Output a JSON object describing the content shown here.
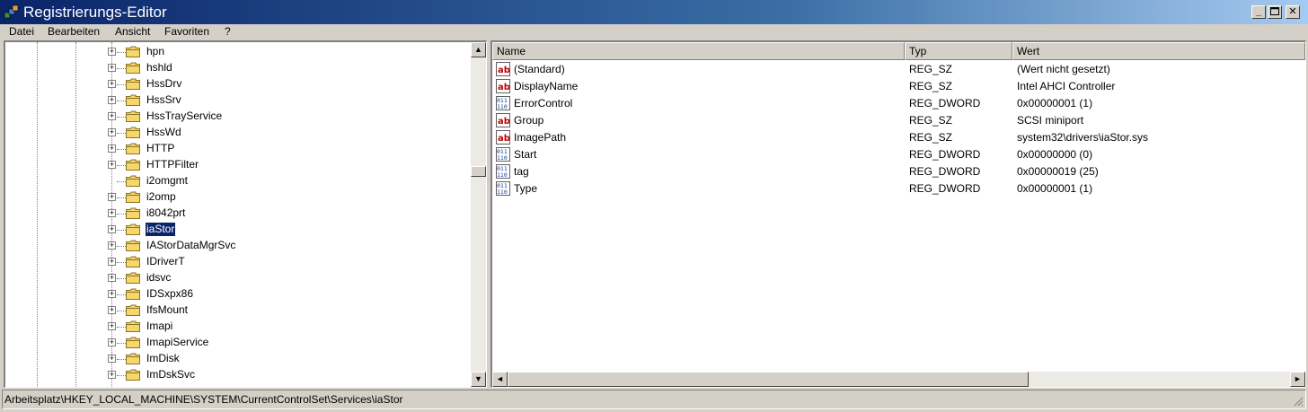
{
  "window": {
    "title": "Registrierungs-Editor"
  },
  "menu": [
    "Datei",
    "Bearbeiten",
    "Ansicht",
    "Favoriten",
    "?"
  ],
  "tree": {
    "items": [
      {
        "label": "hpn",
        "expandable": true,
        "selected": false
      },
      {
        "label": "hshld",
        "expandable": true,
        "selected": false
      },
      {
        "label": "HssDrv",
        "expandable": true,
        "selected": false
      },
      {
        "label": "HssSrv",
        "expandable": true,
        "selected": false
      },
      {
        "label": "HssTrayService",
        "expandable": true,
        "selected": false
      },
      {
        "label": "HssWd",
        "expandable": true,
        "selected": false
      },
      {
        "label": "HTTP",
        "expandable": true,
        "selected": false
      },
      {
        "label": "HTTPFilter",
        "expandable": true,
        "selected": false
      },
      {
        "label": "i2omgmt",
        "expandable": false,
        "selected": false
      },
      {
        "label": "i2omp",
        "expandable": true,
        "selected": false
      },
      {
        "label": "i8042prt",
        "expandable": true,
        "selected": false
      },
      {
        "label": "iaStor",
        "expandable": true,
        "selected": true
      },
      {
        "label": "IAStorDataMgrSvc",
        "expandable": true,
        "selected": false
      },
      {
        "label": "IDriverT",
        "expandable": true,
        "selected": false
      },
      {
        "label": "idsvc",
        "expandable": true,
        "selected": false
      },
      {
        "label": "IDSxpx86",
        "expandable": true,
        "selected": false
      },
      {
        "label": "IfsMount",
        "expandable": true,
        "selected": false
      },
      {
        "label": "Imapi",
        "expandable": true,
        "selected": false
      },
      {
        "label": "ImapiService",
        "expandable": true,
        "selected": false
      },
      {
        "label": "ImDisk",
        "expandable": true,
        "selected": false
      },
      {
        "label": "ImDskSvc",
        "expandable": true,
        "selected": false
      }
    ]
  },
  "values": {
    "columns": [
      "Name",
      "Typ",
      "Wert"
    ],
    "rows": [
      {
        "icon": "string-value-icon",
        "name": "(Standard)",
        "type": "REG_SZ",
        "data": "(Wert nicht gesetzt)"
      },
      {
        "icon": "string-value-icon",
        "name": "DisplayName",
        "type": "REG_SZ",
        "data": "Intel AHCI Controller"
      },
      {
        "icon": "binary-value-icon",
        "name": "ErrorControl",
        "type": "REG_DWORD",
        "data": "0x00000001 (1)"
      },
      {
        "icon": "string-value-icon",
        "name": "Group",
        "type": "REG_SZ",
        "data": "SCSI miniport"
      },
      {
        "icon": "string-value-icon",
        "name": "ImagePath",
        "type": "REG_SZ",
        "data": "system32\\drivers\\iaStor.sys"
      },
      {
        "icon": "binary-value-icon",
        "name": "Start",
        "type": "REG_DWORD",
        "data": "0x00000000 (0)"
      },
      {
        "icon": "binary-value-icon",
        "name": "tag",
        "type": "REG_DWORD",
        "data": "0x00000019 (25)"
      },
      {
        "icon": "binary-value-icon",
        "name": "Type",
        "type": "REG_DWORD",
        "data": "0x00000001 (1)"
      }
    ]
  },
  "status": {
    "path": "Arbeitsplatz\\HKEY_LOCAL_MACHINE\\SYSTEM\\CurrentControlSet\\Services\\iaStor"
  },
  "colors": {
    "title_active": "#0a246a",
    "selection": "#0a246a",
    "face": "#d4d0c8"
  }
}
